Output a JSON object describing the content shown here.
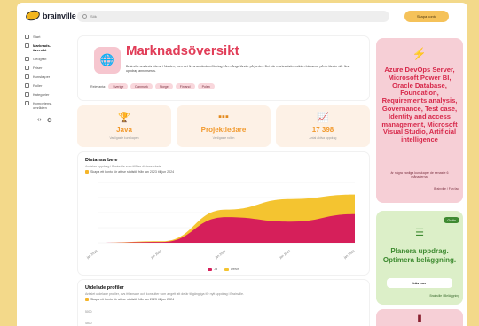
{
  "brand": {
    "name": "brainville"
  },
  "search": {
    "placeholder": "Sök",
    "cta": "Skapa konto"
  },
  "sidebar": {
    "items": [
      {
        "label": "Start",
        "active": false
      },
      {
        "label": "Marknads-översikt",
        "active": true
      },
      {
        "label": "Geografi",
        "active": false
      },
      {
        "label": "Priser",
        "active": false
      },
      {
        "label": "Kunskaper",
        "active": false
      },
      {
        "label": "Roller",
        "active": false
      },
      {
        "label": "Kategorier",
        "active": false
      },
      {
        "label": "Kompetens-områden",
        "active": false
      }
    ]
  },
  "hero": {
    "title": "Marknadsöversikt",
    "description": "Brainville används främst i Norden, men det finns användare/företag från många länder på jorden. Det här marknadsöversikten fokuserar på de länder där flest uppdrag annonseras.",
    "relevance_label": "Relevanta:",
    "tags": [
      "Sverige",
      "Danmark",
      "Norge",
      "Finland",
      "Polen"
    ]
  },
  "stats": [
    {
      "icon": "trophy-icon",
      "value": "Java",
      "caption": "Vanligaste kunskapen"
    },
    {
      "icon": "org-chart-icon",
      "value": "Projektledare",
      "caption": "Vanligaste rollen"
    },
    {
      "icon": "trend-chart-icon",
      "value": "17 398",
      "caption": "Antal aktiva uppdrag"
    }
  ],
  "distance": {
    "title": "Distansarbete",
    "description": "Andelen uppdrag i Brainville som tillåter distansarbete.",
    "note": "Skapa ett konto för att se statistik från jan 2023 till jun 2024",
    "legend": [
      "Ja",
      "Delvis"
    ]
  },
  "chart_data": {
    "type": "area",
    "x": [
      "jan 2019",
      "jan 2020",
      "jan 2021",
      "jan 2022",
      "jan 2023"
    ],
    "series": [
      {
        "name": "Ja",
        "color": "#d61f5a",
        "values": [
          0,
          0.5,
          17,
          14,
          19
        ]
      },
      {
        "name": "Delvis",
        "color": "#f4c430",
        "values": [
          0,
          0.5,
          5,
          15,
          13
        ]
      }
    ],
    "stacked": true,
    "grid": true,
    "legend": "bottom"
  },
  "profiles": {
    "title": "Utdelade profiler",
    "description": "Antalet utdelade profiler, dvs frilansare och konsulter som angett att de är tillgängliga för nytt uppdrag i Brainville.",
    "note": "Skapa ett konto för att se statistik från jan 2023 till jun 2024",
    "axis_top": "5000",
    "axis_next": "4500"
  },
  "promo_pink": {
    "title": "Azure DevOps Server, Microsoft Power BI, Oracle Database, Foundation, Requirements analysis, Governance, Test case, Identity and access management, Microsoft Visual Studio, Artificial intelligence",
    "subtitle": "är några vanliga kunskaper de senaste 6 månaderna.",
    "source": "Brainville / Fun fact"
  },
  "promo_green": {
    "badge": "Gratis",
    "title": "Planera uppdrag. Optimera beläggning.",
    "button": "Läs mer",
    "source": "Brainville / Beläggning"
  },
  "colors": {
    "accent": "#e13d58",
    "orange": "#f29a2e",
    "green": "#3d8a2f",
    "yellow": "#f4c430",
    "background": "#f3d98a"
  }
}
